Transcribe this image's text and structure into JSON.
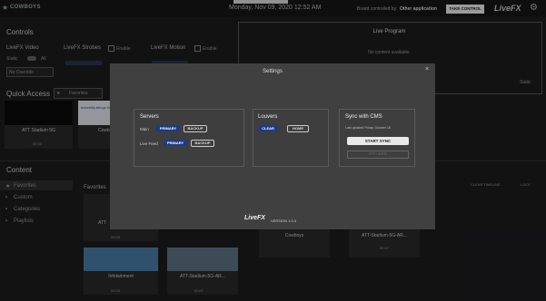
{
  "topbar": {
    "brand": "COWBOYS",
    "datetime": "Monday, Nov 09, 2020  12:52 AM",
    "board_label": "Board controlled by:",
    "board_value": "Other application",
    "take_control": "TAKE CONTROL",
    "app_name": "LiveFX"
  },
  "controls": {
    "title": "Controls",
    "livefx_video": "LiveFX Video",
    "livefx_strobes": "LiveFX Strobes",
    "livefx_motion": "LiveFX Motion",
    "enable": "Enable",
    "static": "Static",
    "all": "All",
    "no_override": "No Override"
  },
  "live_program": {
    "title": "Live Program",
    "no_content": "No content available.",
    "static": "Static"
  },
  "quick_access": {
    "title": "Quick Access",
    "filter": "Favorites",
    "cards": [
      {
        "name": "ATT Stadium 5G",
        "time": "00:03"
      },
      {
        "name": "Cowboys",
        "time": ""
      }
    ],
    "thumb_text": "bebeti6ly.bbugs hig"
  },
  "content": {
    "title": "Content",
    "sidebar": [
      "Favorites",
      "Custom",
      "Categories",
      "Playlists"
    ],
    "favorites_header": "Favorites",
    "clear_timeline": "CLEAR TIMELINE",
    "lock": "LOCK",
    "cards": [
      {
        "name": "ATT",
        "time": "00:03"
      },
      {
        "name": "Infotainment",
        "time": "00:03"
      },
      {
        "name": "ATT-Stadium-5G-AR...",
        "time": "00:07"
      },
      {
        "name": "Cowboys",
        "time": ""
      },
      {
        "name": "ATT-Stadium-5G-AR...",
        "time": "00:07"
      }
    ]
  },
  "settings": {
    "title": "Settings",
    "servers": {
      "title": "Servers",
      "main_label": "Main",
      "live_feed_label": "Live Feed",
      "primary": "PRIMARY",
      "backup": "BACKUP"
    },
    "louvers": {
      "title": "Louvers",
      "clear": "CLEAR",
      "home": "HOME"
    },
    "cms": {
      "title": "Sync with CMS",
      "last_updated": "Last updated Friday, October 16",
      "start_sync": "START SYNC",
      "disabled_btn": "RTF / SOFB"
    },
    "footer_logo": "LiveFX",
    "version": "VERSION 1.0.3"
  }
}
